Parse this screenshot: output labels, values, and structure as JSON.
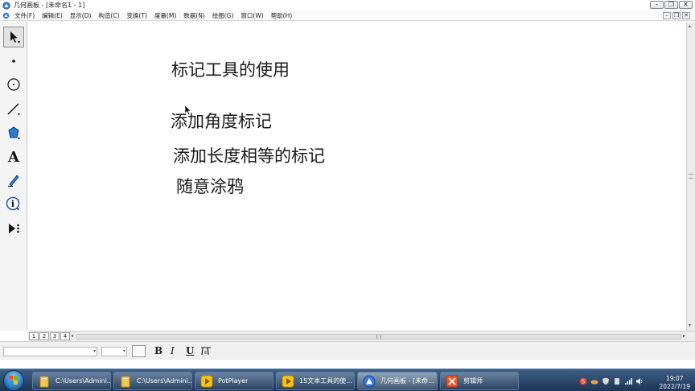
{
  "window": {
    "title": "几何画板 - [未命名1 - 1]",
    "controls": {
      "minimize": "–",
      "restore": "❐",
      "close": "✕"
    }
  },
  "menubar": {
    "items": [
      {
        "label": "文件(F)"
      },
      {
        "label": "编辑(E)"
      },
      {
        "label": "显示(D)"
      },
      {
        "label": "构造(C)"
      },
      {
        "label": "变换(T)"
      },
      {
        "label": "度量(M)"
      },
      {
        "label": "数据(N)"
      },
      {
        "label": "绘图(G)"
      },
      {
        "label": "窗口(W)"
      },
      {
        "label": "帮助(H)"
      }
    ],
    "doc_controls": {
      "minimize": "–",
      "restore": "❐",
      "close": "✕"
    }
  },
  "toolbox": {
    "tools": [
      {
        "icon": "arrow-select-icon",
        "selected": true
      },
      {
        "icon": "point-icon"
      },
      {
        "icon": "compass-icon"
      },
      {
        "icon": "straightedge-icon"
      },
      {
        "icon": "polygon-icon"
      },
      {
        "icon": "text-icon",
        "glyph": "A"
      },
      {
        "icon": "marker-icon"
      },
      {
        "icon": "information-icon",
        "glyph": "i"
      },
      {
        "icon": "custom-tool-icon"
      }
    ]
  },
  "canvas": {
    "texts": [
      {
        "text": "标记工具的使用"
      },
      {
        "text": "添加角度标记"
      },
      {
        "text": "添加长度相等的标记"
      },
      {
        "text": "随意涂鸦"
      }
    ]
  },
  "pages": {
    "tabs": [
      {
        "label": "1"
      },
      {
        "label": "2"
      },
      {
        "label": "3"
      },
      {
        "label": "4"
      }
    ],
    "scroll_left": "◂",
    "scroll_right": "▸"
  },
  "vscroll": {
    "up": "▴",
    "down": "▾"
  },
  "textbar": {
    "font_value": "",
    "size_value": "",
    "bold": "B",
    "italic": "I",
    "underline": "U",
    "symbol_icon": "math-symbol-icon",
    "dropdown_glyph": "▾"
  },
  "taskbar": {
    "buttons": [
      {
        "label": "C:\\Users\\Admini...",
        "icon": "folder-icon",
        "active": false
      },
      {
        "label": "C:\\Users\\Admini...",
        "icon": "folder-icon",
        "active": false
      },
      {
        "label": "PotPlayer",
        "icon": "potplayer-icon",
        "active": false
      },
      {
        "label": "15文本工具的使...",
        "icon": "potplayer-icon",
        "active": false
      },
      {
        "label": "几何画板 - [未命...",
        "icon": "geometry-sketchpad-icon",
        "active": true
      },
      {
        "label": "剪辑师",
        "icon": "video-editor-icon",
        "active": false
      }
    ],
    "clock": {
      "time": "19:07",
      "date": "2022/7/19"
    },
    "colors": {
      "accent": "#2d7bc6",
      "folder": "#f2c84b",
      "potplayer": "#f5c518",
      "editor": "#e8562a"
    }
  }
}
